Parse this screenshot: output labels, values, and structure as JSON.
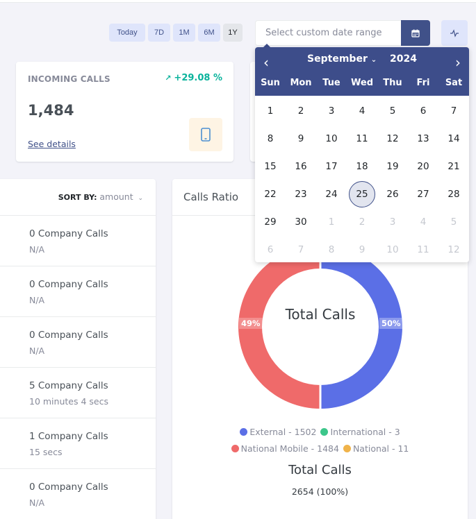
{
  "periods": [
    "Today",
    "7D",
    "1M",
    "6M",
    "1Y"
  ],
  "active_period": "1Y",
  "date_range": {
    "placeholder": "Select custom date range"
  },
  "icons": {
    "calendar": "calendar-icon",
    "pulse": "activity-icon",
    "phone": "mobile-phone-icon",
    "arrow": "arrow-up-right-icon"
  },
  "incoming": {
    "label": "INCOMING CALLS",
    "trend": "+29.08 %",
    "value": "1,484",
    "link": "See details"
  },
  "sort": {
    "label": "SORT BY:",
    "value": "amount"
  },
  "list": [
    {
      "title": "0 Company Calls",
      "sub": "N/A"
    },
    {
      "title": "0 Company Calls",
      "sub": "N/A"
    },
    {
      "title": "0 Company Calls",
      "sub": "N/A"
    },
    {
      "title": "5 Company Calls",
      "sub": "10 minutes 4 secs"
    },
    {
      "title": "1 Company Calls",
      "sub": "15 secs"
    },
    {
      "title": "0 Company Calls",
      "sub": "N/A"
    }
  ],
  "ratio": {
    "title": "Calls Ratio",
    "center": "Total Calls",
    "pct_left": "49%",
    "pct_right": "50%",
    "legend": [
      {
        "label": "External - 1502",
        "color": "#5b6fe6"
      },
      {
        "label": "International - 3",
        "color": "#3cc68a"
      },
      {
        "label": "National Mobile - 1484",
        "color": "#ef6a6a"
      },
      {
        "label": "National - 11",
        "color": "#f0b34a"
      }
    ],
    "total_title": "Total Calls",
    "total_value": "2654 (100%)"
  },
  "calendar": {
    "month": "September",
    "year": "2024",
    "weekdays": [
      "Sun",
      "Mon",
      "Tue",
      "Wed",
      "Thu",
      "Fri",
      "Sat"
    ],
    "days": [
      "1",
      "2",
      "3",
      "4",
      "5",
      "6",
      "7",
      "8",
      "9",
      "10",
      "11",
      "12",
      "13",
      "14",
      "15",
      "16",
      "17",
      "18",
      "19",
      "20",
      "21",
      "22",
      "23",
      "24",
      "25",
      "26",
      "27",
      "28",
      "29",
      "30"
    ],
    "next_days": [
      "1",
      "2",
      "3",
      "4",
      "5",
      "6",
      "7",
      "8",
      "9",
      "10",
      "11",
      "12"
    ],
    "selected": "25"
  }
}
